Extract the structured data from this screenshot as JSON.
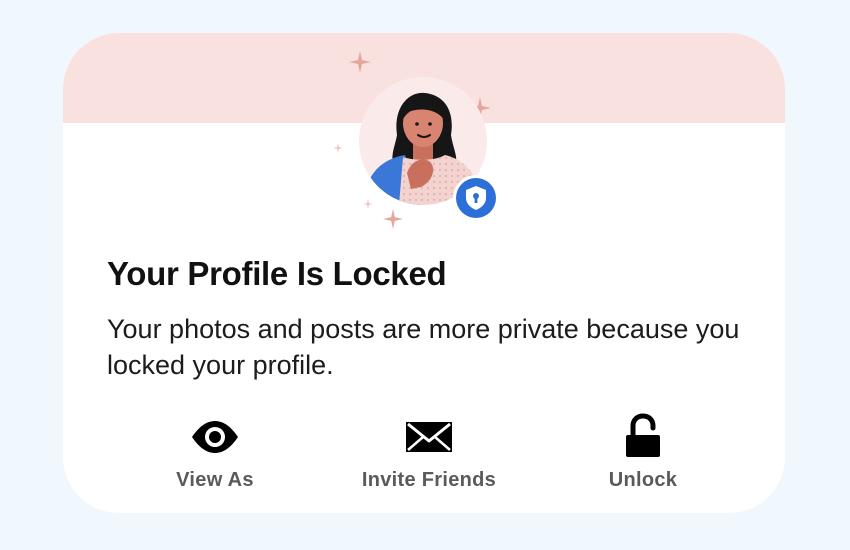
{
  "card": {
    "title": "Your Profile Is Locked",
    "description": "Your photos and posts are more private because you locked your profile."
  },
  "actions": [
    {
      "label": "View As",
      "icon": "eye-icon"
    },
    {
      "label": "Invite Friends",
      "icon": "envelope-icon"
    },
    {
      "label": "Unlock",
      "icon": "unlock-icon"
    }
  ],
  "illustration": {
    "avatar": "person-avatar",
    "badge_icon": "shield-lock-icon"
  },
  "colors": {
    "page_background": "#f1f8fd",
    "banner": "#f9e1df",
    "badge_blue": "#2d6fd8",
    "sparkle": "#e6a6a0",
    "label_gray": "#5a5a5a"
  }
}
